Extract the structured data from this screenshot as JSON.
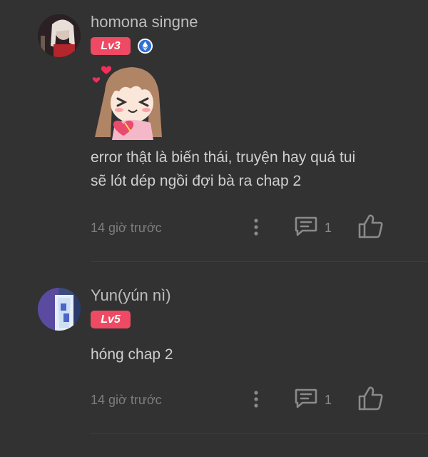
{
  "comments": [
    {
      "username": "homona singne",
      "level": "Lv3",
      "verified": true,
      "text_lines": [
        "error thật là biến thái, truyện hay quá tui",
        "sẽ lót dép ngồi đợi bà ra chap 2"
      ],
      "time": "14 giờ trước",
      "reply_count": "1",
      "has_sticker": true
    },
    {
      "username": "Yun(yún nì)",
      "level": "Lv5",
      "verified": false,
      "text_lines": [
        "hóng chap 2"
      ],
      "time": "14 giờ trước",
      "reply_count": "1",
      "has_sticker": false
    }
  ],
  "colors": {
    "background": "#323232",
    "level_badge": "#ef4a63",
    "verified_badge": "#2f6fd6",
    "muted_text": "#7d7d7d"
  },
  "icons": [
    "more-options-icon",
    "reply-icon",
    "like-icon",
    "verified-icon"
  ]
}
